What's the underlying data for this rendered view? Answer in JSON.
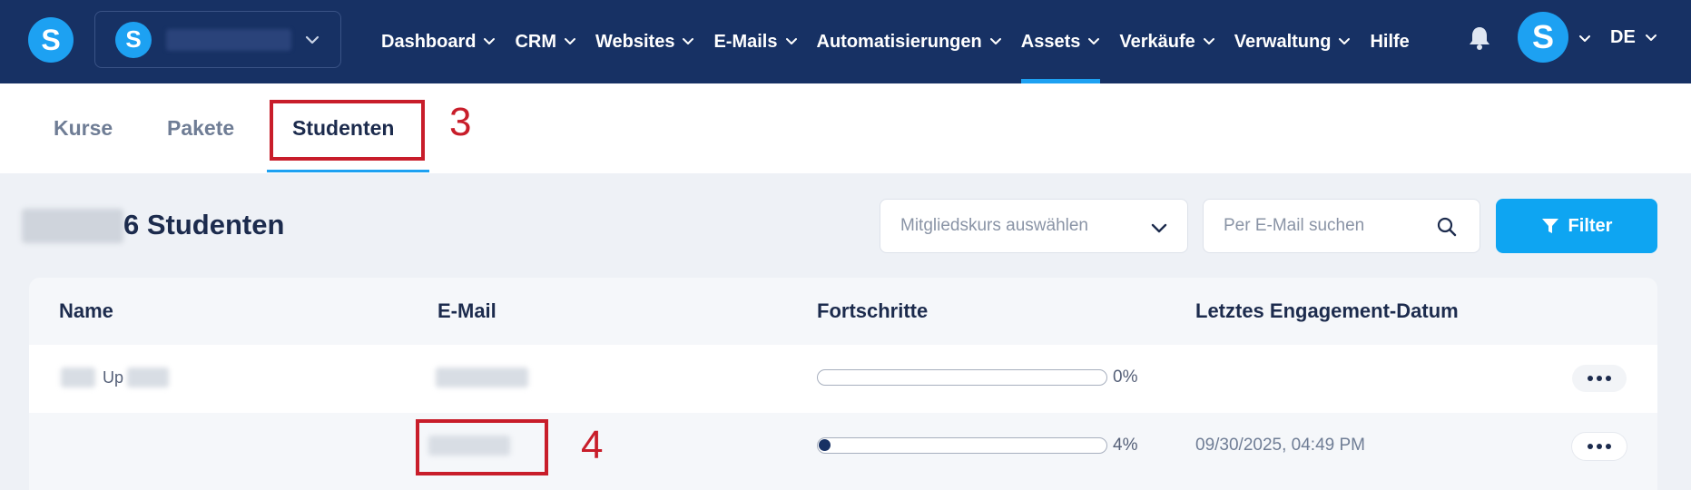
{
  "app": {
    "logo_letter": "S",
    "account_letter": "S",
    "avatar_letter": "S",
    "language": "DE",
    "accent_color": "#1da1f2",
    "nav_bg_color": "#173164"
  },
  "nav": {
    "items": [
      {
        "label": "Dashboard",
        "dropdown": true
      },
      {
        "label": "CRM",
        "dropdown": true
      },
      {
        "label": "Websites",
        "dropdown": true
      },
      {
        "label": "E-Mails",
        "dropdown": true
      },
      {
        "label": "Automatisierungen",
        "dropdown": true
      },
      {
        "label": "Assets",
        "dropdown": true,
        "active": true
      },
      {
        "label": "Verkäufe",
        "dropdown": true
      },
      {
        "label": "Verwaltung",
        "dropdown": true
      },
      {
        "label": "Hilfe",
        "dropdown": false
      }
    ]
  },
  "tabs": [
    {
      "label": "Kurse"
    },
    {
      "label": "Pakete"
    },
    {
      "label": "Studenten",
      "active": true
    }
  ],
  "annotations": {
    "label_3": "3",
    "label_4": "4",
    "color": "#c81d2a"
  },
  "main": {
    "title": "6 Studenten",
    "course_select_placeholder": "Mitgliedskurs auswählen",
    "search_placeholder": "Per E-Mail suchen",
    "filter_label": "Filter"
  },
  "table": {
    "columns": [
      "Name",
      "E-Mail",
      "Fortschritte",
      "Letztes Engagement-Datum"
    ],
    "rows": [
      {
        "name_visible_fragment": "Up",
        "progress": 0,
        "progress_text": "0%",
        "last_engagement": ""
      },
      {
        "name_visible_fragment": "",
        "progress": 0.04,
        "progress_text": "4%",
        "last_engagement": "09/30/2025, 04:49 PM"
      }
    ]
  }
}
